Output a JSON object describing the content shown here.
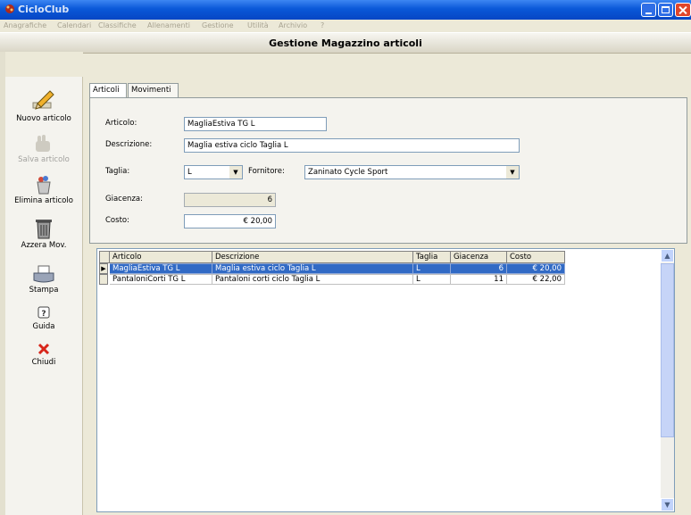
{
  "window": {
    "title": "CicloClub",
    "accent": "#0a58d8"
  },
  "menu": [
    "Anagrafiche",
    "Calendari",
    "Classifiche",
    "Allenamenti",
    "Gestione",
    "Utilità",
    "Archivio",
    "?"
  ],
  "header": {
    "title": "Gestione Magazzino articoli"
  },
  "sidebar": {
    "items": [
      {
        "label": "Nuovo articolo",
        "icon": "pencil-icon"
      },
      {
        "label": "Salva articolo",
        "icon": "hand-icon",
        "disabled": true
      },
      {
        "label": "Elimina articolo",
        "icon": "trash-icon"
      },
      {
        "label": "Azzera Mov.",
        "icon": "bin-icon"
      },
      {
        "label": "Stampa",
        "icon": "printer-icon"
      },
      {
        "label": "Guida",
        "icon": "help-icon"
      },
      {
        "label": "Chiudi",
        "icon": "close-x-icon"
      }
    ]
  },
  "tabs": [
    "Articoli",
    "Movimenti"
  ],
  "form": {
    "articolo_label": "Articolo:",
    "articolo_value": "MagliaEstiva TG L",
    "descrizione_label": "Descrizione:",
    "descrizione_value": "Maglia estiva ciclo Taglia L",
    "taglia_label": "Taglia:",
    "taglia_value": "L",
    "fornitore_label": "Fornitore:",
    "fornitore_value": "Zaninato Cycle Sport",
    "giacenza_label": "Giacenza:",
    "giacenza_value": "6",
    "costo_label": "Costo:",
    "costo_value": "€ 20,00"
  },
  "grid": {
    "columns": [
      "Articolo",
      "Descrizione",
      "Taglia",
      "Giacenza",
      "Costo"
    ],
    "rows": [
      {
        "articolo": "MagliaEstiva TG L",
        "descrizione": "Maglia estiva ciclo Taglia L",
        "taglia": "L",
        "giacenza": "6",
        "costo": "€ 20,00",
        "selected": true
      },
      {
        "articolo": "PantaloniCorti TG L",
        "descrizione": "Pantaloni corti ciclo Taglia L",
        "taglia": "L",
        "giacenza": "11",
        "costo": "€ 22,00",
        "selected": false
      }
    ],
    "selection_color": "#316ac5"
  }
}
